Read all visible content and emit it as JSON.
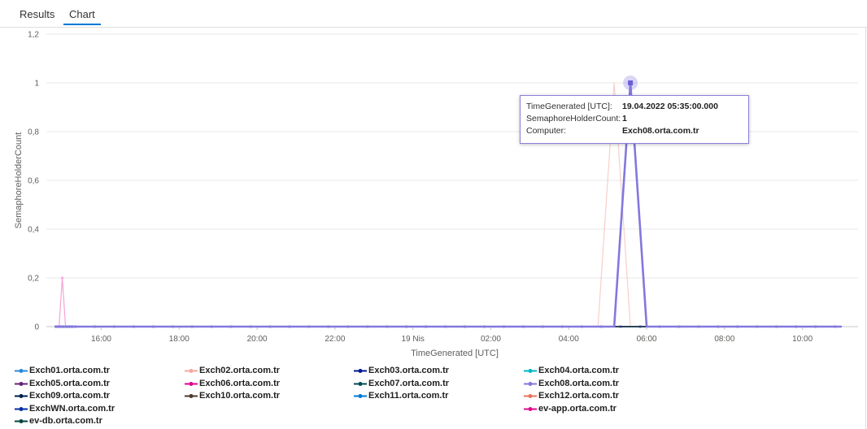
{
  "tabs": [
    {
      "label": "Results",
      "active": false
    },
    {
      "label": "Chart",
      "active": true
    }
  ],
  "chart_data": {
    "type": "line",
    "xlabel": "TimeGenerated [UTC]",
    "ylabel": "SemaphoreHolderCount",
    "ylim": [
      0,
      1.2
    ],
    "y_ticks": [
      "0",
      "0,2",
      "0,4",
      "0,6",
      "0,8",
      "1",
      "1,2"
    ],
    "x_ticks": [
      "16:00",
      "18:00",
      "20:00",
      "22:00",
      "19 Nis",
      "02:00",
      "04:00",
      "06:00",
      "08:00",
      "10:00"
    ],
    "x_range": [
      "18.04.2022 14:48",
      "19.04.2022 11:05"
    ],
    "grid": true,
    "legend_position": "bottom",
    "series": [
      {
        "name": "Exch01.orta.com.tr",
        "color": "#2b88d8",
        "points": [
          [
            "18.04.2022 14:50",
            0
          ],
          [
            "19.04.2022 11:00",
            0
          ]
        ]
      },
      {
        "name": "Exch02.orta.com.tr",
        "color": "#f3a89f",
        "points": [
          [
            "19.04.2022 04:45",
            0
          ],
          [
            "19.04.2022 05:10",
            1
          ],
          [
            "19.04.2022 05:35",
            0
          ]
        ]
      },
      {
        "name": "Exch03.orta.com.tr",
        "color": "#00188f",
        "points": [
          [
            "18.04.2022 14:50",
            0
          ],
          [
            "19.04.2022 11:00",
            0
          ]
        ]
      },
      {
        "name": "Exch04.orta.com.tr",
        "color": "#00b7c3",
        "points": [
          [
            "18.04.2022 14:50",
            0
          ],
          [
            "19.04.2022 11:00",
            0
          ]
        ]
      },
      {
        "name": "Exch05.orta.com.tr",
        "color": "#68217a",
        "points": [
          [
            "18.04.2022 14:50",
            0
          ],
          [
            "19.04.2022 11:00",
            0
          ]
        ]
      },
      {
        "name": "Exch06.orta.com.tr",
        "color": "#e3008c",
        "points": [
          [
            "18.04.2022 14:50",
            0
          ],
          [
            "19.04.2022 11:00",
            0
          ]
        ]
      },
      {
        "name": "Exch07.orta.com.tr",
        "color": "#004b50",
        "points": [
          [
            "18.04.2022 14:50",
            0
          ],
          [
            "19.04.2022 11:00",
            0
          ]
        ]
      },
      {
        "name": "Exch08.orta.com.tr",
        "color": "#8378de",
        "points": [
          [
            "18.04.2022 14:50",
            0
          ],
          [
            "19.04.2022 05:10",
            0
          ],
          [
            "19.04.2022 05:35",
            1
          ],
          [
            "19.04.2022 06:00",
            0
          ],
          [
            "19.04.2022 11:00",
            0
          ]
        ]
      },
      {
        "name": "Exch09.orta.com.tr",
        "color": "#002050",
        "points": [
          [
            "18.04.2022 14:50",
            0
          ],
          [
            "19.04.2022 11:00",
            0
          ]
        ]
      },
      {
        "name": "Exch10.orta.com.tr",
        "color": "#4c3a2b",
        "points": [
          [
            "18.04.2022 14:50",
            0
          ],
          [
            "19.04.2022 11:00",
            0
          ]
        ]
      },
      {
        "name": "Exch11.orta.com.tr",
        "color": "#0078d4",
        "points": [
          [
            "18.04.2022 14:50",
            0
          ],
          [
            "19.04.2022 11:00",
            0
          ]
        ]
      },
      {
        "name": "Exch12.orta.com.tr",
        "color": "#e8735c",
        "points": [
          [
            "18.04.2022 14:50",
            0
          ],
          [
            "19.04.2022 11:00",
            0
          ]
        ]
      },
      {
        "name": "ExchWN.orta.com.tr",
        "color": "#002ea6",
        "points": [
          [
            "18.04.2022 14:50",
            0
          ],
          [
            "19.04.2022 11:00",
            0
          ]
        ]
      },
      {
        "name": "ev-app.orta.com.tr",
        "color": "#e00b8e",
        "points": [
          [
            "18.04.2022 14:50",
            0
          ],
          [
            "19.04.2022 11:00",
            0
          ]
        ]
      },
      {
        "name": "ev-db.orta.com.tr",
        "color": "#00453d",
        "points": [
          [
            "18.04.2022 14:50",
            0
          ],
          [
            "19.04.2022 11:00",
            0
          ]
        ]
      },
      {
        "name": "",
        "color": "#f5a3d6",
        "points": [
          [
            "18.04.2022 14:55",
            0
          ],
          [
            "18.04.2022 15:00",
            0.2
          ],
          [
            "18.04.2022 15:05",
            0
          ]
        ]
      }
    ]
  },
  "tooltip": {
    "rows": [
      {
        "key": "TimeGenerated [UTC]:",
        "value": "19.04.2022 05:35:00.000"
      },
      {
        "key": "SemaphoreHolderCount:",
        "value": "1"
      },
      {
        "key": "Computer:",
        "value": "Exch08.orta.com.tr"
      }
    ]
  }
}
